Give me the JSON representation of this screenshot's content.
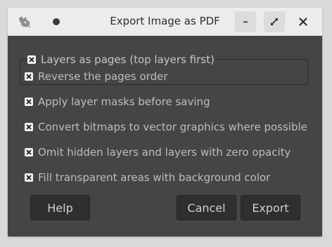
{
  "window": {
    "title": "Export Image as PDF",
    "icon": "gimp-wilber-icon",
    "controls": [
      "pin-dot-icon",
      "minimize-icon",
      "maximize-icon",
      "close-icon"
    ]
  },
  "options": {
    "layers_as_pages": {
      "label": "Layers as pages (top layers first)",
      "checked": true
    },
    "reverse_order": {
      "label": "Reverse the pages order",
      "checked": true
    },
    "apply_masks": {
      "label": "Apply layer masks before saving",
      "checked": true
    },
    "convert_bitmaps": {
      "label": "Convert bitmaps to vector graphics where possible",
      "checked": true
    },
    "omit_hidden": {
      "label": "Omit hidden layers and layers with zero opacity",
      "checked": true
    },
    "fill_transparent": {
      "label": "Fill transparent areas with background color",
      "checked": true
    }
  },
  "buttons": {
    "help": "Help",
    "cancel": "Cancel",
    "export": "Export"
  },
  "colors": {
    "titlebar": "#ececec",
    "dialog_bg": "#454545",
    "text": "#bdbdbd",
    "button_bg": "#2f2f2f"
  }
}
